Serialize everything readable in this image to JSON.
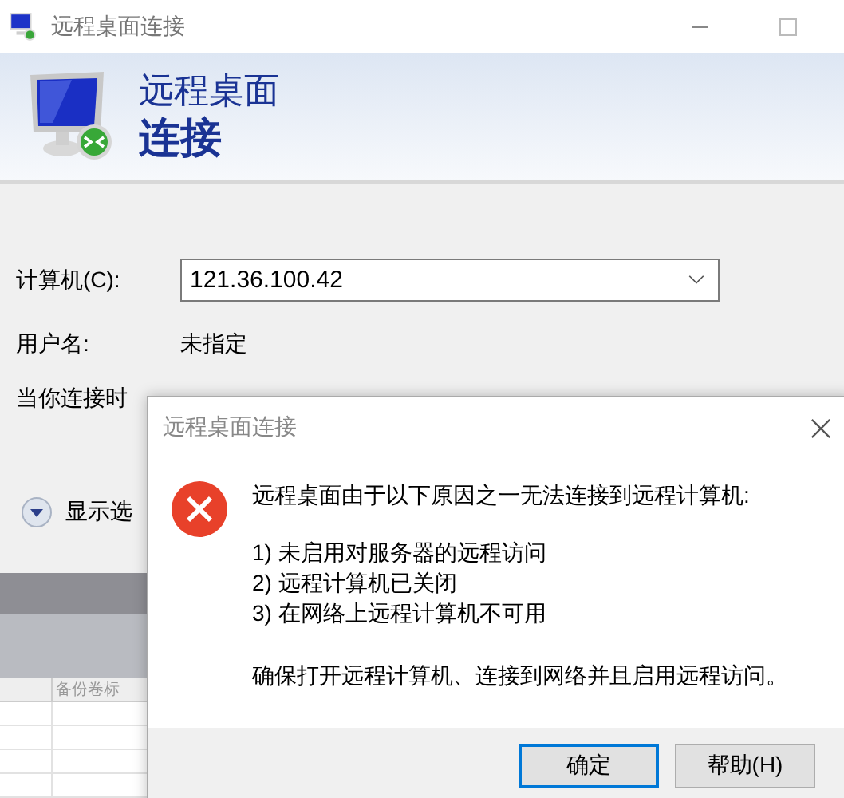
{
  "window": {
    "title": "远程桌面连接"
  },
  "header": {
    "line_1": "远程桌面",
    "line_2": "连接"
  },
  "computer": {
    "label": "计算机(C):",
    "value": "121.36.100.42"
  },
  "username": {
    "label": "用户名:",
    "value": "未指定"
  },
  "connect_note": "当你连接时",
  "options_toggle": {
    "label": "显示选",
    "expanded": false
  },
  "background_table": {
    "columns": [
      "备份卷标"
    ]
  },
  "dialog": {
    "title": "远程桌面连接",
    "message": "远程桌面由于以下原因之一无法连接到远程计算机:",
    "reasons": [
      "1) 未启用对服务器的远程访问",
      "2) 远程计算机已关闭",
      "3) 在网络上远程计算机不可用"
    ],
    "advice": "确保打开远程计算机、连接到网络并且启用远程访问。",
    "buttons": [
      {
        "label": "确定",
        "default": true
      },
      {
        "label": "帮助(H)",
        "default": false
      }
    ]
  }
}
